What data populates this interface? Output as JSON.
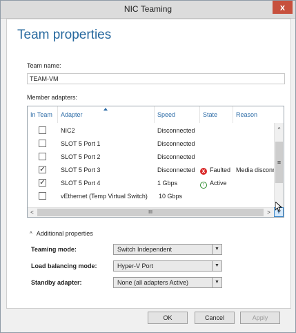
{
  "window": {
    "title": "NIC Teaming",
    "close_label": "x"
  },
  "heading": "Team properties",
  "team_name": {
    "label": "Team name:",
    "value": "TEAM-VM"
  },
  "member_adapters": {
    "label": "Member adapters:",
    "columns": [
      "In Team",
      "Adapter",
      "Speed",
      "State",
      "Reason"
    ],
    "rows": [
      {
        "checked": false,
        "check_mark": "",
        "adapter": "NIC2",
        "speed": "Disconnected",
        "state": "",
        "reason": ""
      },
      {
        "checked": false,
        "check_mark": "",
        "adapter": "SLOT 5 Port 1",
        "speed": "Disconnected",
        "state": "",
        "reason": ""
      },
      {
        "checked": false,
        "check_mark": "",
        "adapter": "SLOT 5 Port 2",
        "speed": "Disconnected",
        "state": "",
        "reason": ""
      },
      {
        "checked": true,
        "check_mark": "✓",
        "adapter": "SLOT 5 Port 3",
        "speed": "Disconnected",
        "state": "Faulted",
        "reason": "Media disconnected"
      },
      {
        "checked": true,
        "check_mark": "✓",
        "adapter": "SLOT 5 Port 4",
        "speed": "1 Gbps",
        "state": "Active",
        "reason": ""
      },
      {
        "checked": false,
        "check_mark": "",
        "adapter": "vEthernet (Temp Virtual Switch)",
        "speed": "10 Gbps",
        "state": "",
        "reason": ""
      }
    ],
    "scroll": {
      "up": "^",
      "down": "v",
      "left": "<",
      "right": ">",
      "thumb_grip": "III",
      "vthumb_grip": "≡"
    }
  },
  "additional_properties": {
    "toggle_label": "Additional properties",
    "chevron": "^",
    "teaming_mode": {
      "label": "Teaming mode:",
      "value": "Switch Independent"
    },
    "load_balancing_mode": {
      "label": "Load balancing mode:",
      "value": "Hyper-V Port"
    },
    "standby_adapter": {
      "label": "Standby adapter:",
      "value": "None (all adapters Active)"
    },
    "dropdown_arrow": "▼"
  },
  "buttons": {
    "ok": "OK",
    "cancel": "Cancel",
    "apply": "Apply"
  },
  "state_icons": {
    "faulted": "x",
    "active": "↑"
  },
  "colors": {
    "heading": "#26689e",
    "close": "#c7503d",
    "faulted": "#d92a2a",
    "active": "#2b8a2b"
  }
}
